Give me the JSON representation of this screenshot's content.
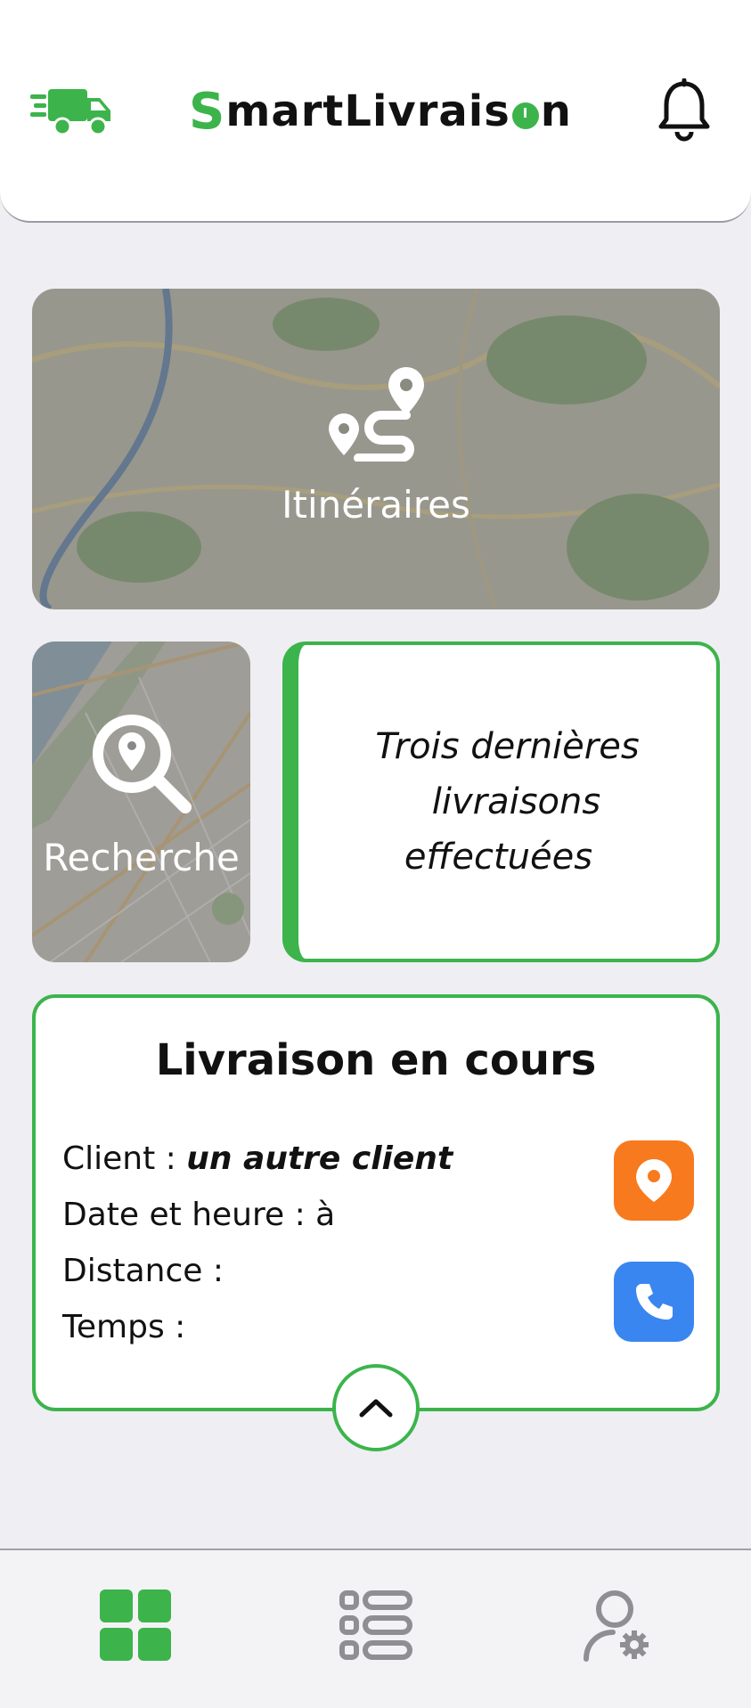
{
  "header": {
    "logo": {
      "part1": "S",
      "part2": "martLivrais",
      "part3": "n"
    },
    "icons": [
      "truck-icon",
      "bell-icon"
    ],
    "accent_color": "#3cb44b"
  },
  "cards": {
    "itineraires": {
      "label": "Itinéraires",
      "icon": "route-icon"
    },
    "recherche": {
      "label": "Recherche",
      "icon": "search-location-icon"
    },
    "last_deliveries": {
      "line1": "Trois dernières",
      "line2": "livraisons effectuées"
    }
  },
  "current_delivery": {
    "title": "Livraison en cours",
    "client_label": "Client : ",
    "client_value": "un autre client",
    "datetime_label": "Date et heure : à",
    "distance_label": "Distance :",
    "time_label": "Temps :",
    "location_color": "#f77a1e",
    "call_color": "#3a86f0"
  },
  "nav": {
    "items": [
      "dashboard-icon",
      "list-icon",
      "user-settings-icon"
    ],
    "active_color": "#3cb44b",
    "inactive_color": "#8e8e93"
  }
}
